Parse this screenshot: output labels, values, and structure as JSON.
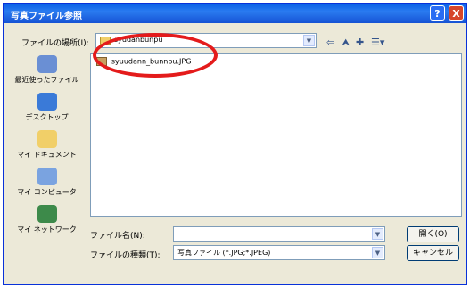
{
  "window": {
    "title": "写真ファイル参照",
    "help_label": "?",
    "close_label": "X"
  },
  "location": {
    "label": "ファイルの場所(I):",
    "value": "syudanbunpu"
  },
  "places": [
    {
      "label": "最近使ったファイル",
      "icon": "recent-icon"
    },
    {
      "label": "デスクトップ",
      "icon": "desktop-icon"
    },
    {
      "label": "マイ ドキュメント",
      "icon": "my-documents-icon"
    },
    {
      "label": "マイ コンピュータ",
      "icon": "my-computer-icon"
    },
    {
      "label": "マイ ネットワーク",
      "icon": "my-network-icon"
    }
  ],
  "files": [
    {
      "name": "syuudann_bunnpu.JPG"
    }
  ],
  "filename": {
    "label": "ファイル名(N):",
    "value": ""
  },
  "filetype": {
    "label": "ファイルの種類(T):",
    "value": "写真ファイル (*.JPG;*.JPEG)"
  },
  "buttons": {
    "open": "開く(O)",
    "cancel": "キャンセル"
  },
  "colors": {
    "titlebar": "#0a5fe6",
    "annotation": "#e41b1b"
  }
}
